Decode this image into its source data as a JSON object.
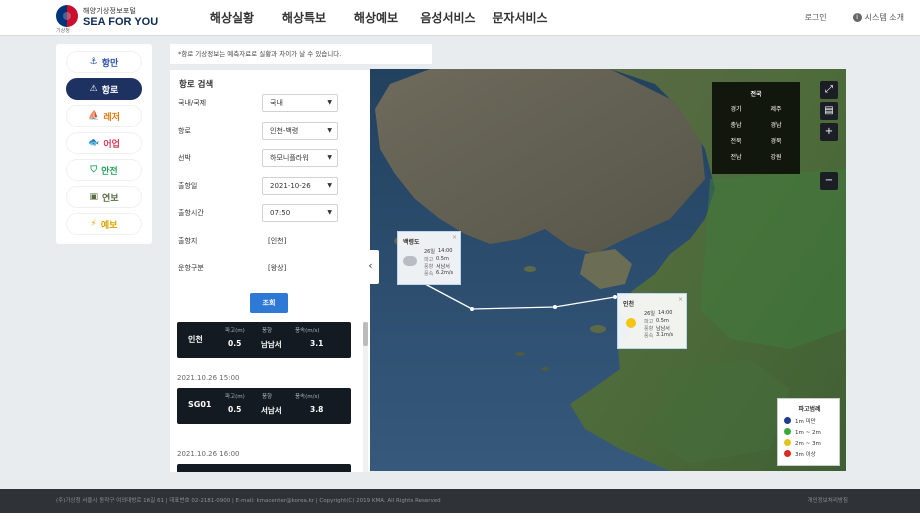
{
  "header": {
    "logo": {
      "line1": "해양기상정보포털",
      "line2": "SEA FOR YOU",
      "org": "기상청"
    },
    "menu": [
      "해상실황",
      "해상특보",
      "해상예보",
      "음성서비스",
      "문자서비스"
    ],
    "login": "로그인",
    "system_intro": "시스템 소개"
  },
  "nav": {
    "items": [
      {
        "label": "항만",
        "icon": "⚓",
        "color": "#2b4fa2"
      },
      {
        "label": "항로",
        "icon": "⚠",
        "color": "#ffffff",
        "active": true
      },
      {
        "label": "레저",
        "icon": "⛵",
        "color": "#e07a10"
      },
      {
        "label": "어업",
        "icon": "🐟",
        "color": "#d53b5a"
      },
      {
        "label": "안전",
        "icon": "⛉",
        "color": "#23a35a"
      },
      {
        "label": "연보",
        "icon": "▣",
        "color": "#5a6a40"
      },
      {
        "label": "예보",
        "icon": "⚡",
        "color": "#d9a400"
      }
    ]
  },
  "notice": "*항로 기상정보는 예측자료로 실황과 차이가 날 수 있습니다.",
  "panel": {
    "title": "항로 검색",
    "fields": [
      {
        "label": "국내/국제",
        "value": "국내",
        "type": "select"
      },
      {
        "label": "항로",
        "value": "인천-백령",
        "type": "select"
      },
      {
        "label": "선박",
        "value": "하모니플라워",
        "type": "select"
      },
      {
        "label": "출항일",
        "value": "2021-10-26",
        "type": "select"
      },
      {
        "label": "출항시간",
        "value": "07:50",
        "type": "select"
      },
      {
        "label": "출항지",
        "value": "[인천]",
        "type": "text"
      },
      {
        "label": "운항구분",
        "value": "[왕상]",
        "type": "text"
      }
    ],
    "search_button": "조회",
    "results": [
      {
        "time": "",
        "station": "인천",
        "headers": [
          "파고(m)",
          "풍향",
          "풍속(m/s)"
        ],
        "values": [
          "0.5",
          "남남서",
          "3.1"
        ]
      },
      {
        "time": "2021.10.26 15:00",
        "station": "SG01",
        "headers": [
          "파고(m)",
          "풍향",
          "풍속(m/s)"
        ],
        "values": [
          "0.5",
          "서남서",
          "3.8"
        ]
      },
      {
        "time": "2021.10.26 16:00",
        "station": "",
        "headers": [],
        "values": []
      }
    ]
  },
  "map": {
    "region_title": "전국",
    "regions": [
      "경기",
      "제주",
      "충남",
      "경남",
      "전북",
      "경북",
      "전남",
      "강원"
    ],
    "popups": [
      {
        "title": "백령도",
        "date": "26일",
        "time": "14:00",
        "labels": [
          "파고",
          "풍향",
          "풍속"
        ],
        "values": [
          "0.5m",
          "서남서",
          "6.2m/s"
        ]
      },
      {
        "title": "인천",
        "date": "26일",
        "time": "14:00",
        "labels": [
          "파고",
          "풍향",
          "풍속"
        ],
        "values": [
          "0.5m",
          "남남서",
          "3.1m/s"
        ]
      }
    ],
    "legend": {
      "title": "파고범례",
      "items": [
        {
          "label": "1m 미만",
          "color": "#1f3f8a"
        },
        {
          "label": "1m ~ 2m",
          "color": "#3aa83a"
        },
        {
          "label": "2m ~ 3m",
          "color": "#e3c21a"
        },
        {
          "label": "3m 이상",
          "color": "#d82a1e"
        }
      ]
    }
  },
  "footer": {
    "text": "(주)기상청 서울시 동작구 여의대방로 16길 61 | 대표번호 02-2181-0900 | E-mail: kmacenter@korea.kr | Copyright(C) 2019 KMA. All Rights Reserved",
    "right": "개인정보처리방침"
  }
}
